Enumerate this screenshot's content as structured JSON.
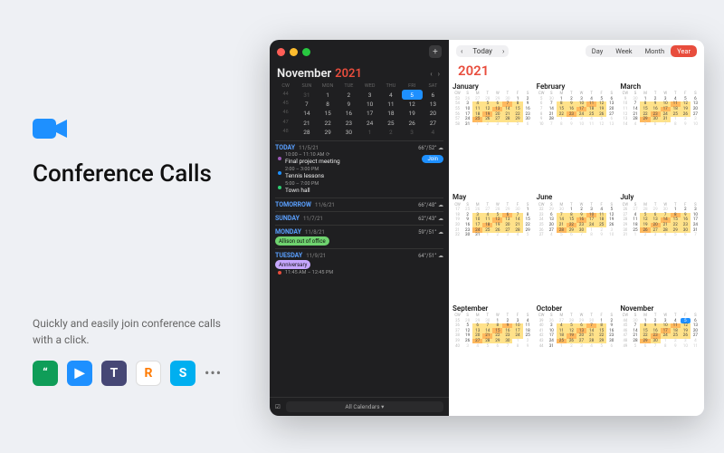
{
  "promo": {
    "title": "Conference Calls",
    "subtitle": "Quickly and easily join conference calls with a click.",
    "apps": [
      "hangouts",
      "zoom",
      "teams",
      "ringcentral",
      "skype"
    ]
  },
  "window": {
    "month": "November",
    "year": "2021",
    "dow": [
      "CW",
      "SUN",
      "MON",
      "TUE",
      "WED",
      "THU",
      "FRI",
      "SAT"
    ],
    "mini": [
      {
        "cw": "44",
        "d": [
          "31",
          "1",
          "2",
          "3",
          "4",
          "5",
          "6"
        ],
        "today": 5
      },
      {
        "cw": "45",
        "d": [
          "7",
          "8",
          "9",
          "10",
          "11",
          "12",
          "13"
        ]
      },
      {
        "cw": "46",
        "d": [
          "14",
          "15",
          "16",
          "17",
          "18",
          "19",
          "20"
        ]
      },
      {
        "cw": "47",
        "d": [
          "21",
          "22",
          "23",
          "24",
          "25",
          "26",
          "27"
        ]
      },
      {
        "cw": "48",
        "d": [
          "28",
          "29",
          "30",
          "1",
          "2",
          "3",
          "4"
        ]
      }
    ],
    "agenda": [
      {
        "label": "TODAY",
        "date": "11/5/21",
        "weather": "66°/52°",
        "events": [
          {
            "color": "#9b59b6",
            "time": "10:00 – 11:10 AM ⟳",
            "title": "Final project meeting",
            "join": true,
            "join_label": "Join"
          },
          {
            "color": "#1e90ff",
            "time": "2:00 – 3:00 PM",
            "title": "Tennis lessons"
          },
          {
            "color": "#2ecc71",
            "time": "5:00 – 7:00 PM",
            "title": "Town hall"
          }
        ]
      },
      {
        "label": "TOMORROW",
        "date": "11/6/21",
        "weather": "66°/48°"
      },
      {
        "label": "SUNDAY",
        "date": "11/7/21",
        "weather": "62°/43°"
      },
      {
        "label": "MONDAY",
        "date": "11/8/21",
        "weather": "59°/51°",
        "pill": {
          "text": "Allison out of office",
          "bg": "#6fd36f"
        }
      },
      {
        "label": "TUESDAY",
        "date": "11/9/21",
        "weather": "64°/51°",
        "pill": {
          "text": "Anniversary",
          "bg": "#c6a7ff"
        },
        "events": [
          {
            "color": "#e84d3d",
            "time": "11:45 AM – 12:45 PM",
            "title": ""
          }
        ]
      }
    ],
    "footer": {
      "all": "All Calendars ▾"
    },
    "toolbar": {
      "today": "Today",
      "views": [
        "Day",
        "Week",
        "Month",
        "Year"
      ],
      "active": "Year"
    },
    "yearTitle": "2021",
    "months": [
      "January",
      "February",
      "March",
      "May",
      "June",
      "July",
      "September",
      "October",
      "November"
    ],
    "ym_dow": [
      "CW",
      "S",
      "M",
      "T",
      "W",
      "T",
      "F",
      "S"
    ]
  }
}
